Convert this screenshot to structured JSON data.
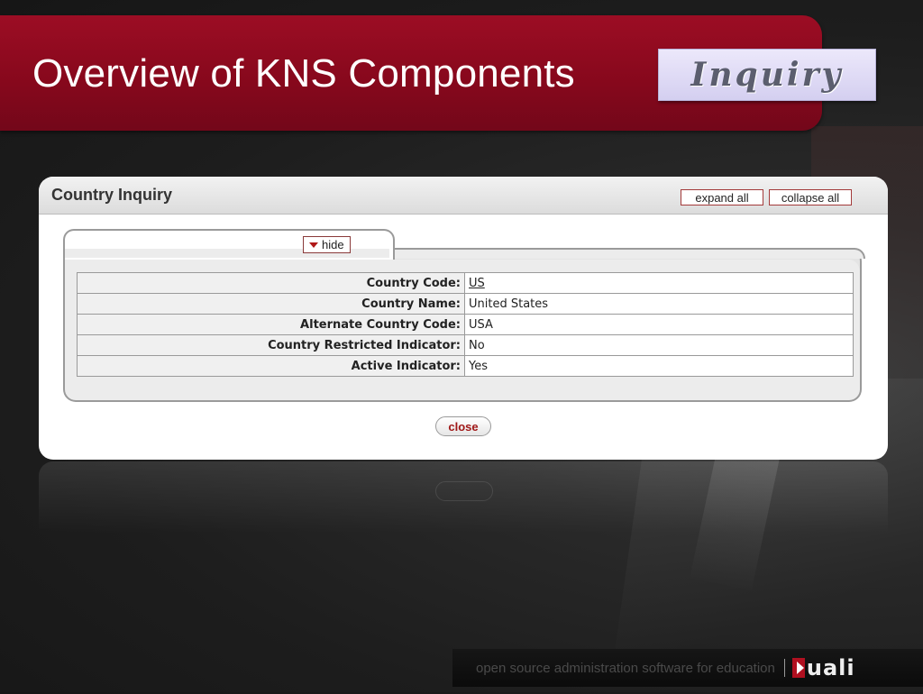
{
  "slide": {
    "title": "Overview of KNS Components",
    "badge": "Inquiry"
  },
  "panel": {
    "title": "Country Inquiry",
    "expand_label": "expand all",
    "collapse_label": "collapse all",
    "hide_label": "hide",
    "close_label": "close",
    "rows": [
      {
        "label": "Country Code:",
        "value": "US"
      },
      {
        "label": "Country Name:",
        "value": "United States"
      },
      {
        "label": "Alternate Country Code:",
        "value": "USA"
      },
      {
        "label": "Country Restricted Indicator:",
        "value": "No"
      },
      {
        "label": "Active Indicator:",
        "value": "Yes"
      }
    ]
  },
  "footer": {
    "tagline": "open source administration software for education",
    "logo_text": "uali"
  },
  "colors": {
    "brand_red": "#9c0d24",
    "badge_bg": "#d4cff0",
    "background": "#1d1d1d"
  }
}
